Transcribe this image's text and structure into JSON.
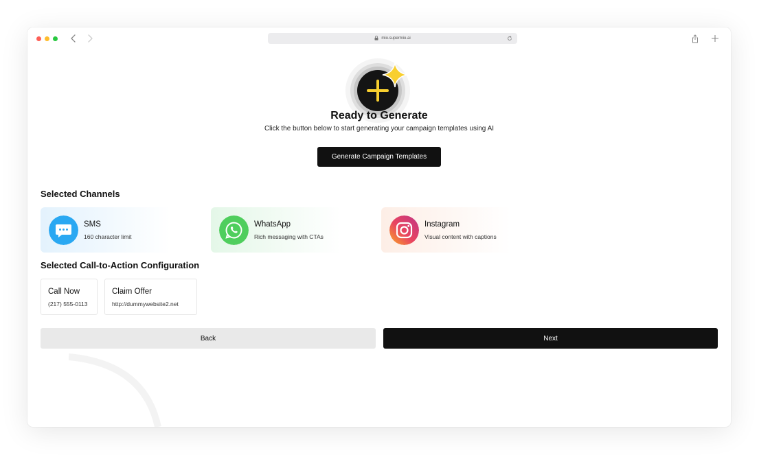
{
  "browser": {
    "url": "mio.supermio.ai"
  },
  "hero": {
    "title": "Ready to Generate",
    "subtitle": "Click the button below to start generating your campaign templates using AI",
    "button_label": "Generate Campaign Templates",
    "icon": "sparkle-plus-icon"
  },
  "channels": {
    "title": "Selected Channels",
    "items": [
      {
        "name": "SMS",
        "description": "160 character limit",
        "icon": "sms-chat-icon",
        "color": "#2aa8f2"
      },
      {
        "name": "WhatsApp",
        "description": "Rich messaging with CTAs",
        "icon": "whatsapp-icon",
        "color": "#4fce5d"
      },
      {
        "name": "Instagram",
        "description": "Visual content with captions",
        "icon": "instagram-icon",
        "color": "#e1306c"
      }
    ]
  },
  "cta": {
    "title": "Selected Call-to-Action Configuration",
    "items": [
      {
        "label": "Call Now",
        "value": "(217) 555-0113"
      },
      {
        "label": "Claim Offer",
        "value": "http://dummywebsite2.net"
      }
    ]
  },
  "footer": {
    "back_label": "Back",
    "next_label": "Next"
  },
  "colors": {
    "primary": "#111111",
    "accent": "#f8cf2f"
  }
}
